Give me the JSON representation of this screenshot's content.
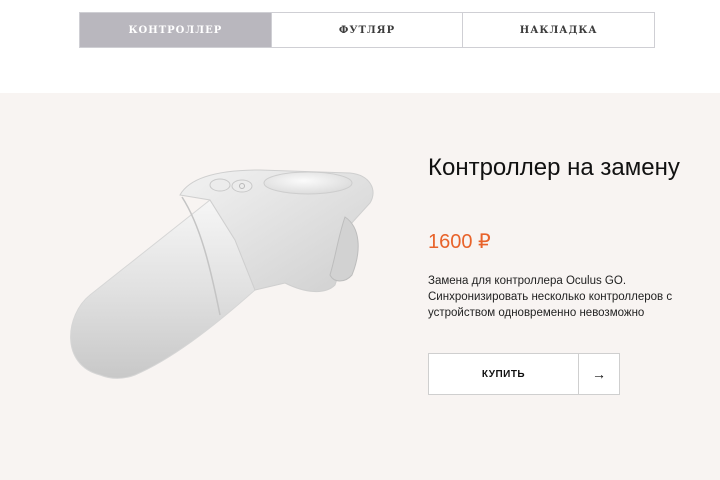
{
  "tabs": [
    {
      "label": "КОНТРОЛЛЕР",
      "active": true
    },
    {
      "label": "ФУТЛЯР",
      "active": false
    },
    {
      "label": "НАКЛАДКА",
      "active": false
    }
  ],
  "product": {
    "image_icon": "oculus-go-controller-image",
    "title": "Контроллер на замену",
    "price": "1600 ₽",
    "description": "Замена для контроллера Oculus GO. Синхронизировать несколько контроллеров с устройством одновременно невозможно",
    "buy_label": "КУПИТЬ",
    "arrow_symbol": "→"
  },
  "colors": {
    "active_tab": "#b9b7be",
    "section_bg": "#f8f4f2",
    "price": "#e8632b"
  }
}
